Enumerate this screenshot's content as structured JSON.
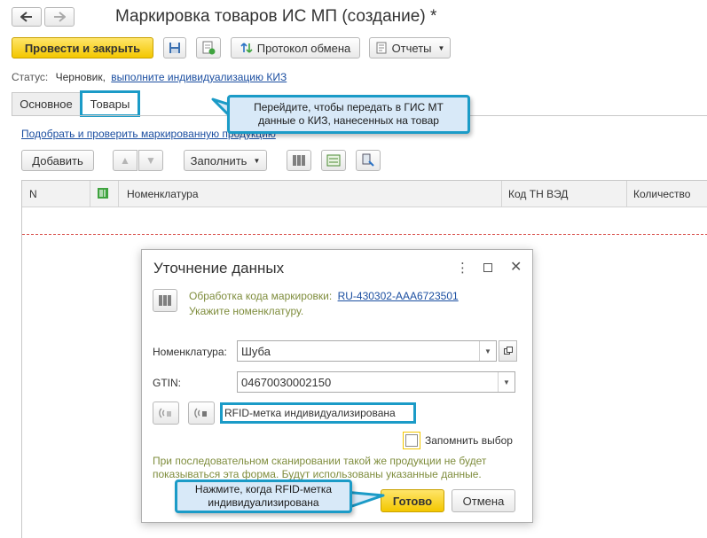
{
  "window": {
    "title": "Маркировка товаров ИС МП (создание) *"
  },
  "toolbar": {
    "post_close": "Провести и закрыть",
    "exchange": "Протокол обмена",
    "reports": "Отчеты"
  },
  "status": {
    "label": "Статус:",
    "value": "Черновик,",
    "link": "выполните индивидуализацию КИЗ"
  },
  "tabs": [
    {
      "label": "Основное"
    },
    {
      "label": "Товары"
    }
  ],
  "goods": {
    "select_link": "Подобрать и проверить маркированную продукцию",
    "add_button": "Добавить",
    "fill_button": "Заполнить",
    "columns": [
      "N",
      "Номенклатура",
      "Код ТН ВЭД",
      "Количество"
    ]
  },
  "callouts": {
    "top": [
      "Перейдите, чтобы передать в ГИС МТ",
      "данные о КИЗ, нанесенных на товар"
    ],
    "bottom": [
      "Нажмите, когда RFID-метка",
      "индивидуализирована"
    ]
  },
  "dialog": {
    "title": "Уточнение данных",
    "processing_label": "Обработка кода маркировки:",
    "processing_code": "RU-430302-AAA6723501",
    "hint": "Укажите номенклатуру.",
    "nomenclature_label": "Номенклатура:",
    "nomenclature_value": "Шуба",
    "gtin_label": "GTIN:",
    "gtin_value": "04670030002150",
    "rfid_label": "RFID-метка индивидуализирована",
    "remember_label": "Запомнить выбор",
    "info": [
      "При последовательном сканировании такой же продукции не будет",
      "показываться эта форма. Будут использованы указанные данные."
    ],
    "ok_button": "Готово",
    "cancel_button": "Отмена"
  },
  "colors": {
    "accent_yellow": "#f3c700",
    "callout_border": "#1b9bc7",
    "callout_fill": "#d8e9f8",
    "link": "#1c4fa1",
    "hint_green": "#7f8d3d",
    "dashed_red": "#d9534f"
  }
}
